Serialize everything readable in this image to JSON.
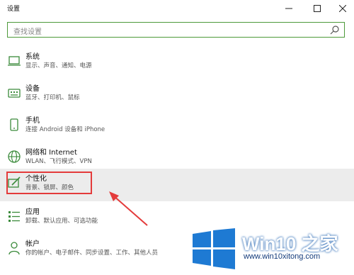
{
  "window": {
    "title": "设置"
  },
  "search": {
    "placeholder": "查找设置"
  },
  "items": [
    {
      "label": "系统",
      "desc": "显示、声音、通知、电源",
      "icon": "laptop-icon"
    },
    {
      "label": "设备",
      "desc": "蓝牙、打印机、鼠标",
      "icon": "keyboard-icon"
    },
    {
      "label": "手机",
      "desc": "连接 Android 设备和 iPhone",
      "icon": "phone-icon"
    },
    {
      "label": "网络和 Internet",
      "desc": "WLAN、飞行模式、VPN",
      "icon": "globe-icon"
    },
    {
      "label": "个性化",
      "desc": "背景、锁屏、颜色",
      "icon": "paint-icon",
      "selected": true
    },
    {
      "label": "应用",
      "desc": "卸载、默认应用、可选功能",
      "icon": "apps-list-icon"
    },
    {
      "label": "帐户",
      "desc": "你的帐户、电子邮件、同步设置、工作、其他人员",
      "icon": "person-icon"
    }
  ],
  "watermark": {
    "title": "Win10 之家",
    "url": "www.win10xitong.com"
  },
  "colors": {
    "accent": "#4d9a3a",
    "highlight": "#e43b3b",
    "selected_bg": "#ececec"
  }
}
